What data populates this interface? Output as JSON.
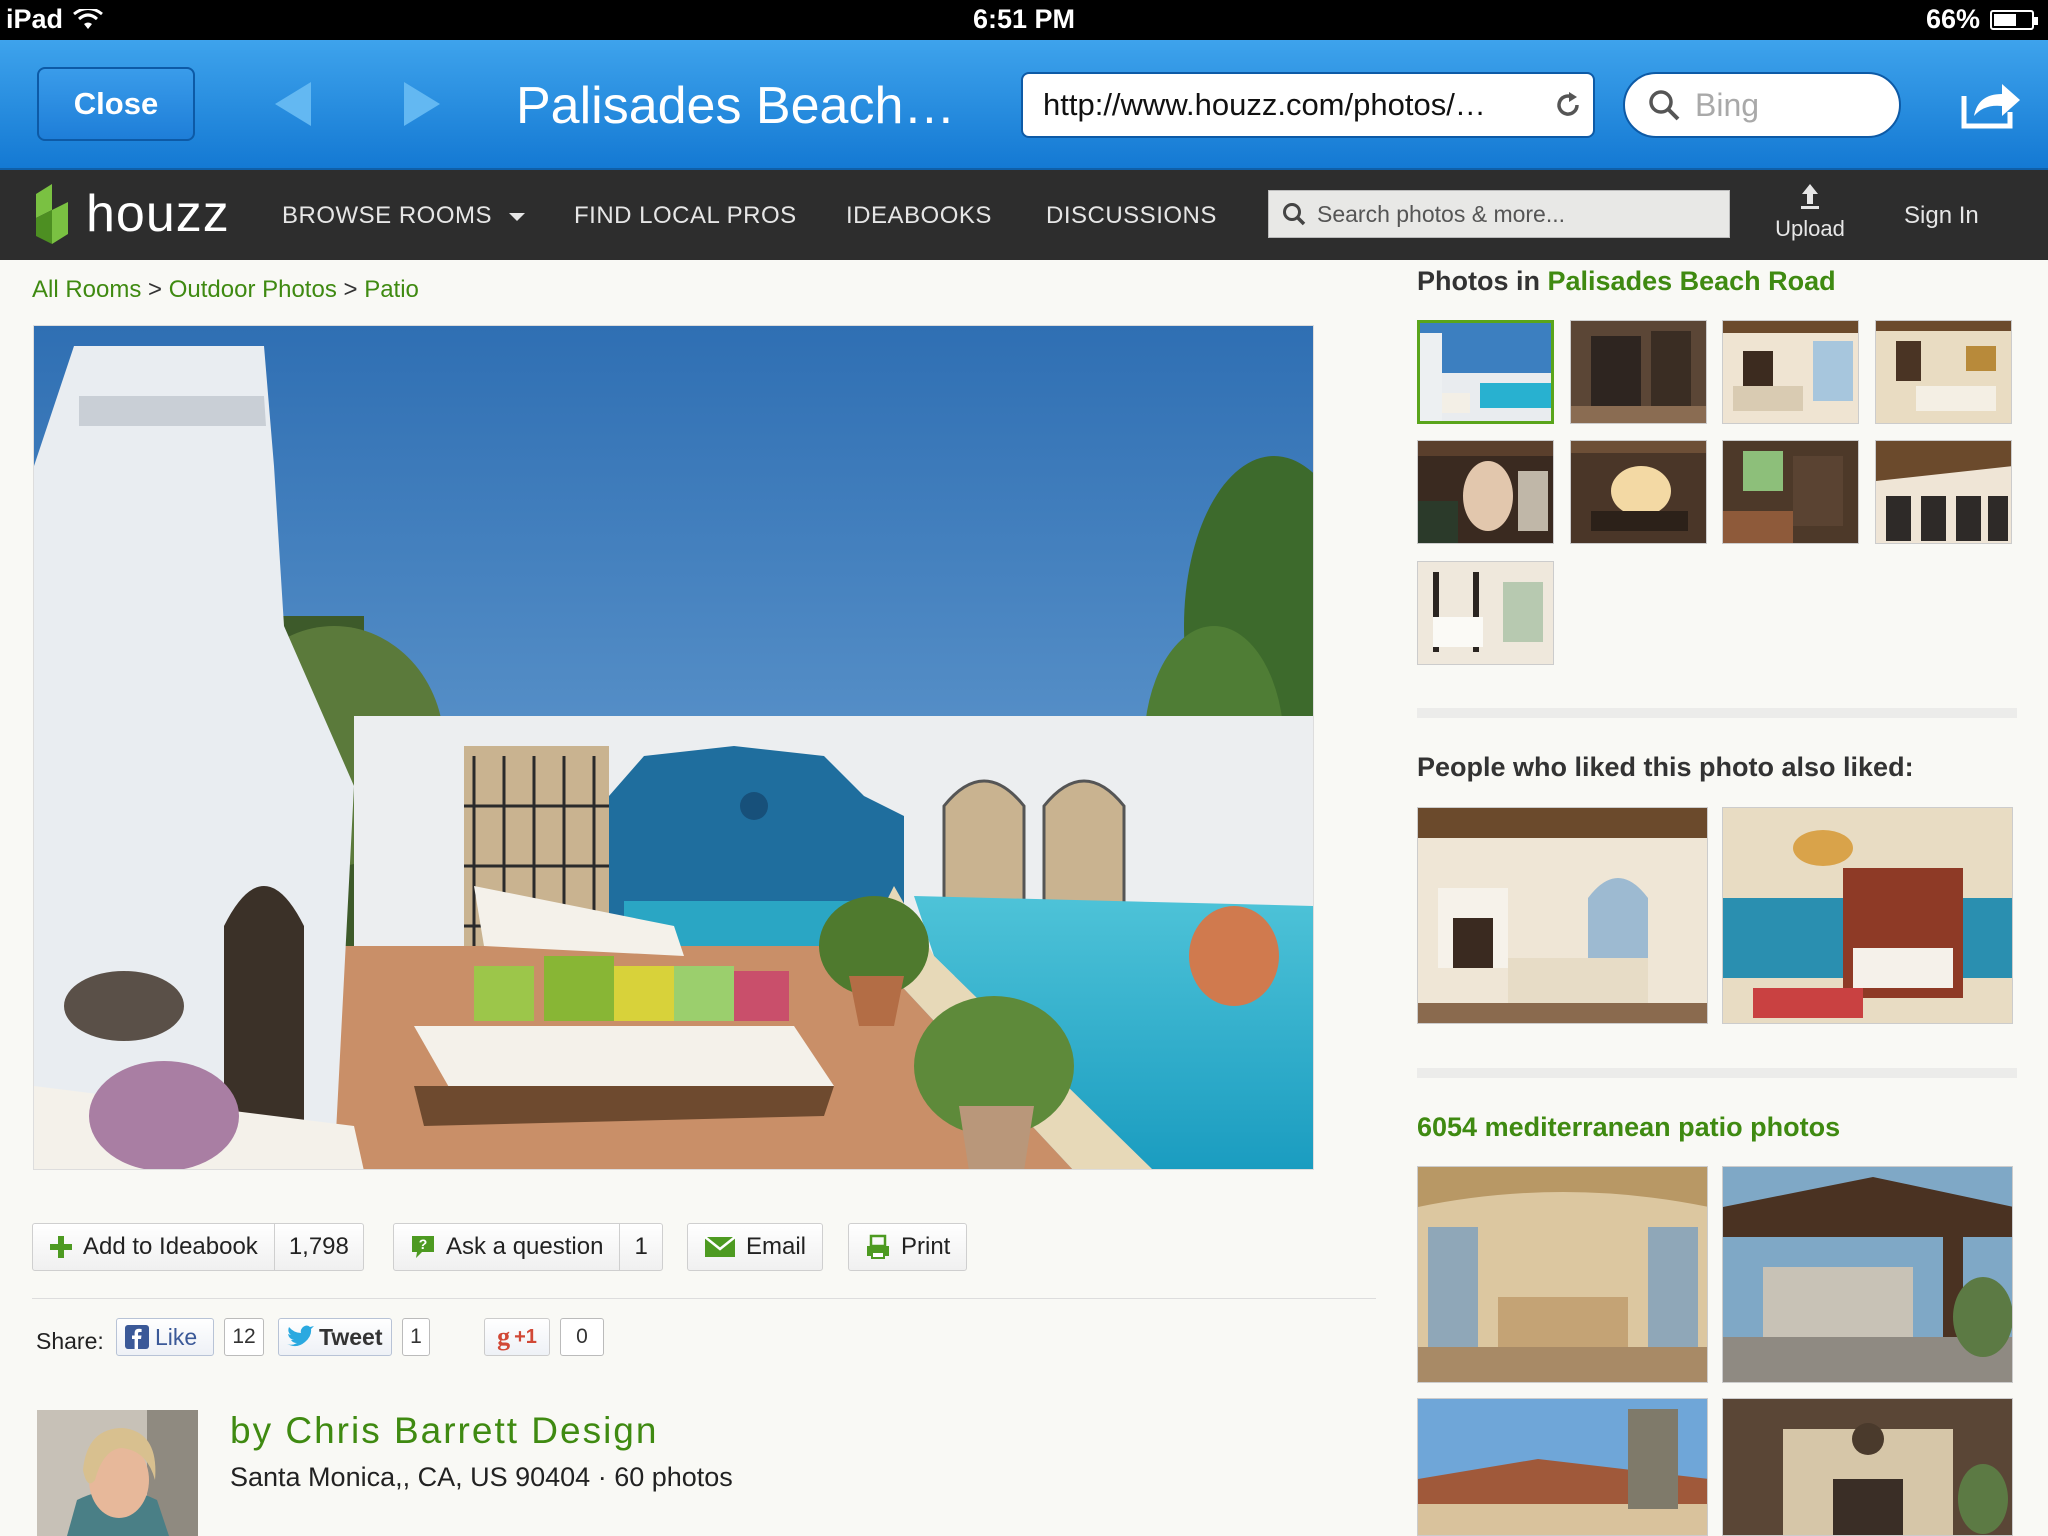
{
  "status_bar": {
    "device": "iPad",
    "time": "6:51 PM",
    "battery": "66%",
    "battery_level": 0.66
  },
  "browser": {
    "close_label": "Close",
    "page_title": "Palisades Beach…",
    "url": "http://www.houzz.com/photos/…",
    "search_placeholder": "Bing"
  },
  "houzz_nav": {
    "logo_text": "houzz",
    "items": [
      "BROWSE ROOMS",
      "FIND LOCAL PROS",
      "IDEABOOKS",
      "DISCUSSIONS"
    ],
    "search_placeholder": "Search photos & more...",
    "upload_label": "Upload",
    "signin_label": "Sign In"
  },
  "breadcrumb": {
    "items": [
      "All Rooms",
      "Outdoor Photos",
      "Patio"
    ],
    "separator": ">"
  },
  "actions": {
    "ideabook_label": "Add to Ideabook",
    "ideabook_count": "1,798",
    "question_label": "Ask a question",
    "question_count": "1",
    "email_label": "Email",
    "print_label": "Print"
  },
  "share": {
    "label": "Share:",
    "like_label": "Like",
    "like_count": "12",
    "tweet_label": "Tweet",
    "tweet_count": "1",
    "gplus_label": "+1",
    "gplus_count": "0"
  },
  "author": {
    "name": "by Chris Barrett Design",
    "location": "Santa Monica,, CA, US 90404 · 60 photos"
  },
  "sidebar": {
    "photos_in_prefix": "Photos in",
    "photos_in_project": "Palisades Beach Road",
    "also_liked_heading": "People who liked this photo also liked:",
    "more_photos_heading": "6054 mediterranean patio photos"
  }
}
